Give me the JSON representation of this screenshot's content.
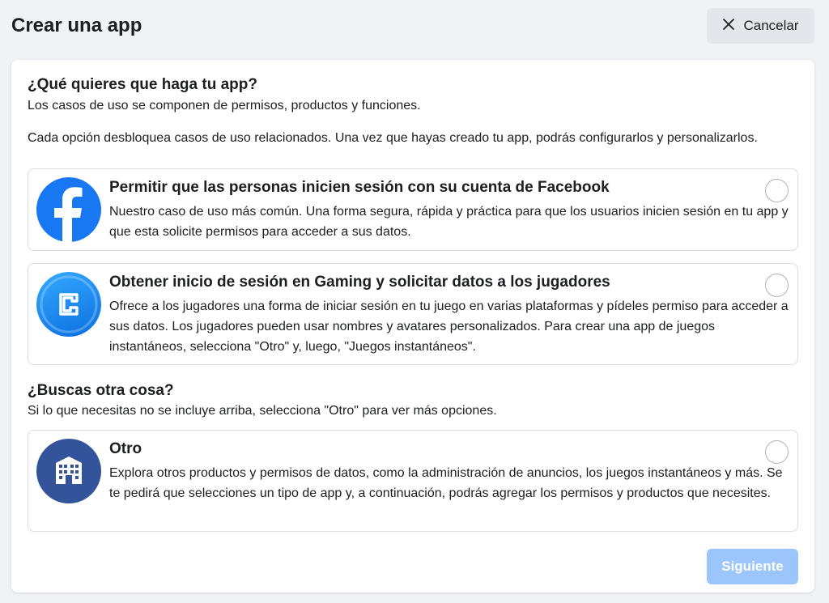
{
  "header": {
    "title": "Crear una app",
    "cancel_label": "Cancelar"
  },
  "use_cases": {
    "heading": "¿Qué quieres que haga tu app?",
    "subtitle": "Los casos de uso se componen de permisos, productos y funciones.",
    "description": "Cada opción desbloquea casos de uso relacionados. Una vez que hayas creado tu app, podrás configurarlos y personalizarlos."
  },
  "options": [
    {
      "title": "Permitir que las personas inicien sesión con su cuenta de Facebook",
      "description": "Nuestro caso de uso más común. Una forma segura, rápida y práctica para que los usuarios inicien sesión en tu app y que esta solicite permisos para acceder a sus datos.",
      "icon": "facebook-logo-icon",
      "selected": false
    },
    {
      "title": "Obtener inicio de sesión en Gaming y solicitar datos a los jugadores",
      "description": "Ofrece a los jugadores una forma de iniciar sesión en tu juego en varias plataformas y pídeles permiso para acceder a sus datos. Los jugadores pueden usar nombres y avatares personalizados. Para crear una app de juegos instantáneos, selecciona \"Otro\" y, luego, \"Juegos instantáneos\".",
      "icon": "gaming-icon",
      "selected": false
    },
    {
      "title": "Otro",
      "description": "Explora otros productos y permisos de datos, como la administración de anuncios, los juegos instantáneos y más. Se te pedirá que selecciones un tipo de app y, a continuación, podrás agregar los permisos y productos que necesites.",
      "icon": "building-icon",
      "selected": false
    }
  ],
  "other": {
    "heading": "¿Buscas otra cosa?",
    "subtitle": "Si lo que necesitas no se incluye arriba, selecciona \"Otro\" para ver más opciones."
  },
  "footer": {
    "next_label": "Siguiente",
    "next_disabled": true
  },
  "colors": {
    "facebook_blue": "#1877f2",
    "gaming_blue": "#1b8ef0",
    "other_navy": "#33549a",
    "next_disabled_bg": "#9cc5fb"
  }
}
